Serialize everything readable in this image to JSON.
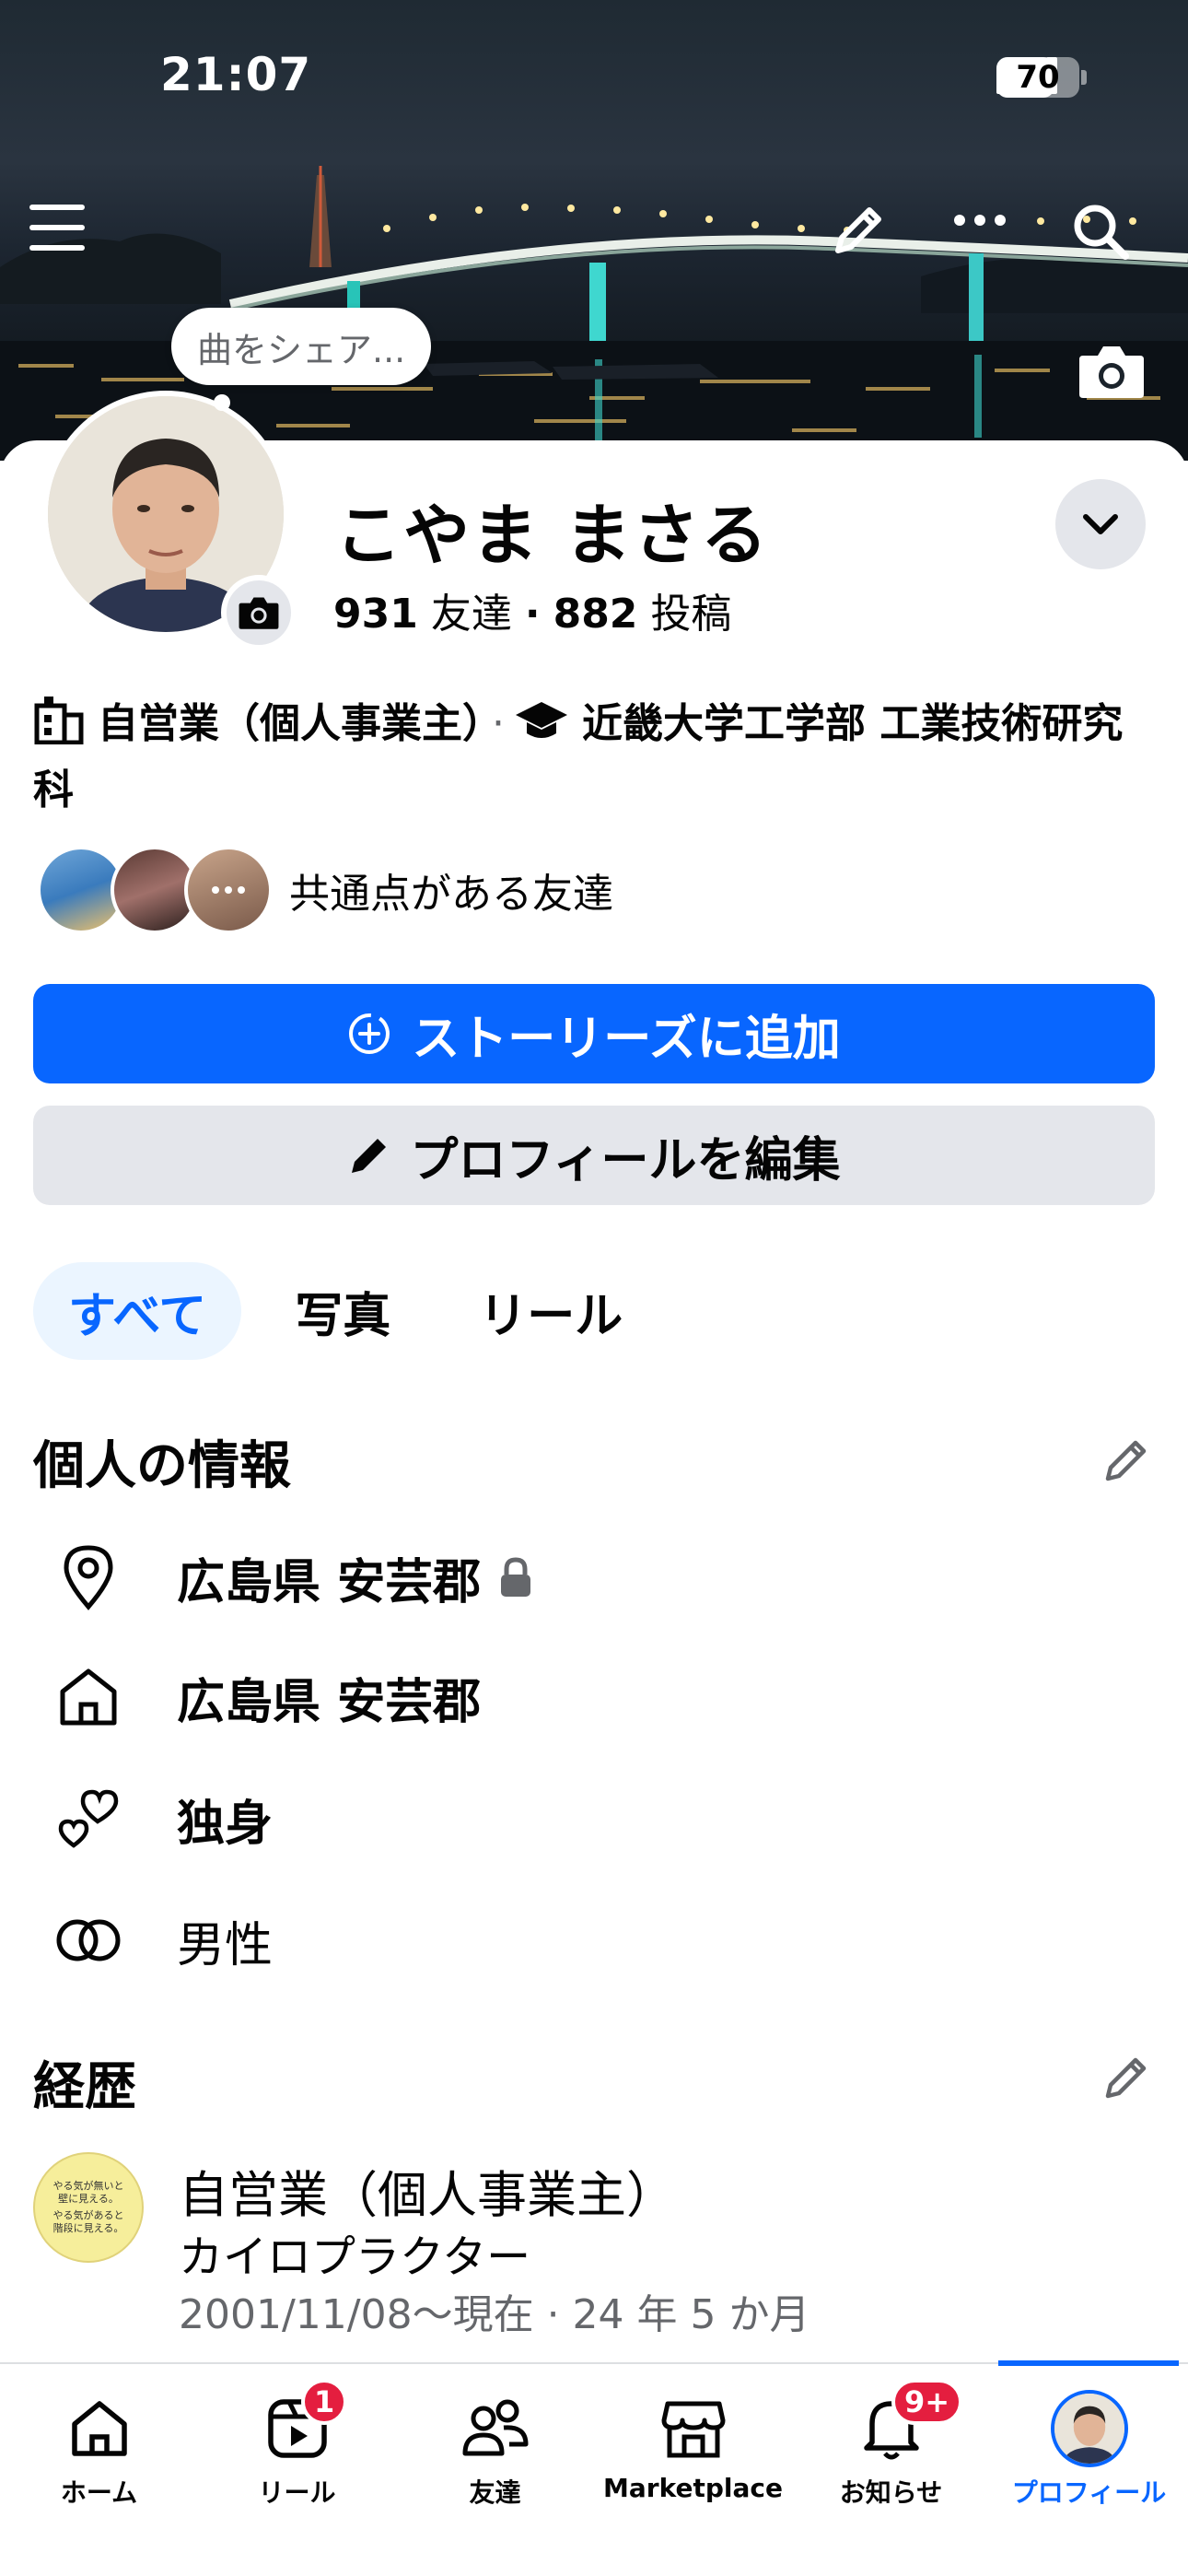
{
  "status_bar": {
    "time": "21:07",
    "battery": "70",
    "battery_level": 0.7
  },
  "cover": {
    "song_share_label": "曲をシェア..."
  },
  "profile": {
    "name": "こやま まさる",
    "friends_count": "931",
    "friends_label": "友達",
    "dot": "·",
    "posts_count": "882",
    "posts_label": "投稿",
    "work": "自営業（個人事業主）",
    "work_separator": "·",
    "education": "近畿大学工学部  工業技術研究科",
    "mutual_label": "共通点がある友達"
  },
  "actions": {
    "add_story": "ストーリーズに追加",
    "edit_profile": "プロフィールを編集"
  },
  "tabs": [
    {
      "label": "すべて",
      "active": true
    },
    {
      "label": "写真",
      "active": false
    },
    {
      "label": "リール",
      "active": false
    }
  ],
  "personal_info": {
    "title": "個人の情報",
    "items": [
      {
        "icon": "location-pin-icon",
        "text": "広島県 安芸郡",
        "locked": true
      },
      {
        "icon": "home-icon",
        "text": "広島県 安芸郡"
      },
      {
        "icon": "hearts-icon",
        "text": "独身"
      },
      {
        "icon": "gender-icon",
        "text": "男性"
      }
    ]
  },
  "career": {
    "title": "経歴",
    "job_title": "自営業（個人事業主）",
    "job_role": "カイロプラクター",
    "job_date": "2001/11/08〜現在 · 24 年 5 か月",
    "logo_text_1": "やる気が無いと",
    "logo_text_2": "壁に見える。",
    "logo_text_3": "やる気があると",
    "logo_text_4": "階段に見える。"
  },
  "bottom_nav": {
    "items": [
      {
        "label": "ホーム",
        "icon": "home-icon"
      },
      {
        "label": "リール",
        "icon": "reels-icon",
        "badge": "1"
      },
      {
        "label": "友達",
        "icon": "friends-icon"
      },
      {
        "label": "Marketplace",
        "icon": "marketplace-icon"
      },
      {
        "label": "お知らせ",
        "icon": "bell-icon",
        "badge": "9+"
      },
      {
        "label": "プロフィール",
        "icon": "profile-avatar",
        "active": true
      }
    ]
  },
  "colors": {
    "primary": "#0866ff",
    "badge": "#e41e3f",
    "secondary_button": "#e4e6eb",
    "muted_text": "#65676b"
  }
}
